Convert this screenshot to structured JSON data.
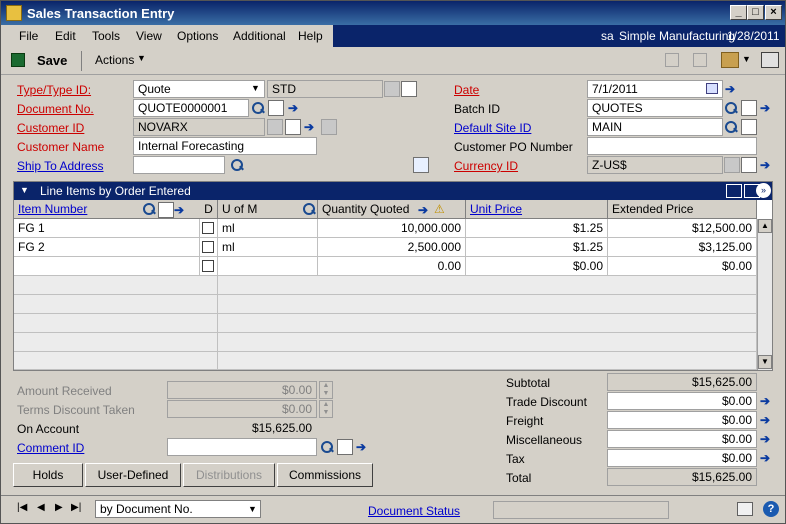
{
  "window": {
    "title": "Sales Transaction Entry"
  },
  "menu": [
    "File",
    "Edit",
    "Tools",
    "View",
    "Options",
    "Additional",
    "Help"
  ],
  "status_bar": {
    "user": "sa",
    "company": "Simple Manufacturing",
    "date": "1/28/2011"
  },
  "toolbar": {
    "save": "Save",
    "actions": "Actions"
  },
  "header": {
    "type_label": "Type/Type ID:",
    "type_value": "Quote",
    "type_id": "STD",
    "docno_label": "Document No.",
    "docno_value": "QUOTE0000001",
    "custid_label": "Customer ID",
    "custid_value": "NOVARX",
    "custname_label": "Customer Name",
    "custname_value": "Internal Forecasting",
    "shipto_label": "Ship To Address",
    "date_label": "Date",
    "date_value": "7/1/2011",
    "batch_label": "Batch ID",
    "batch_value": "QUOTES",
    "site_label": "Default Site ID",
    "site_value": "MAIN",
    "po_label": "Customer PO Number",
    "po_value": "",
    "currency_label": "Currency ID",
    "currency_value": "Z-US$"
  },
  "grid": {
    "title": "Line Items by Order Entered",
    "columns": {
      "item": "Item Number",
      "d": "D",
      "uom": "U of M",
      "qty": "Quantity Quoted",
      "price": "Unit Price",
      "ext": "Extended Price"
    },
    "rows": [
      {
        "item": "FG 1",
        "uom": "ml",
        "qty": "10,000.000",
        "price": "$1.25",
        "ext": "$12,500.00"
      },
      {
        "item": "FG 2",
        "uom": "ml",
        "qty": "2,500.000",
        "price": "$1.25",
        "ext": "$3,125.00"
      },
      {
        "item": "",
        "uom": "",
        "qty": "0.00",
        "price": "$0.00",
        "ext": "$0.00"
      }
    ]
  },
  "left_totals": {
    "amount_received_label": "Amount Received",
    "amount_received": "$0.00",
    "terms_discount_label": "Terms Discount Taken",
    "terms_discount": "$0.00",
    "on_account_label": "On Account",
    "on_account": "$15,625.00",
    "comment_label": "Comment ID",
    "comment_value": ""
  },
  "right_totals": {
    "subtotal_label": "Subtotal",
    "subtotal": "$15,625.00",
    "trade_discount_label": "Trade Discount",
    "trade_discount": "$0.00",
    "freight_label": "Freight",
    "freight": "$0.00",
    "misc_label": "Miscellaneous",
    "misc": "$0.00",
    "tax_label": "Tax",
    "tax": "$0.00",
    "total_label": "Total",
    "total": "$15,625.00"
  },
  "buttons": {
    "holds": "Holds",
    "user_defined": "User-Defined",
    "distributions": "Distributions",
    "commissions": "Commissions"
  },
  "footer": {
    "sort": "by Document No.",
    "doc_status": "Document Status"
  },
  "colors": {
    "titlebar": "#0a246a",
    "required": "#cc0000",
    "link": "#0000cc"
  }
}
